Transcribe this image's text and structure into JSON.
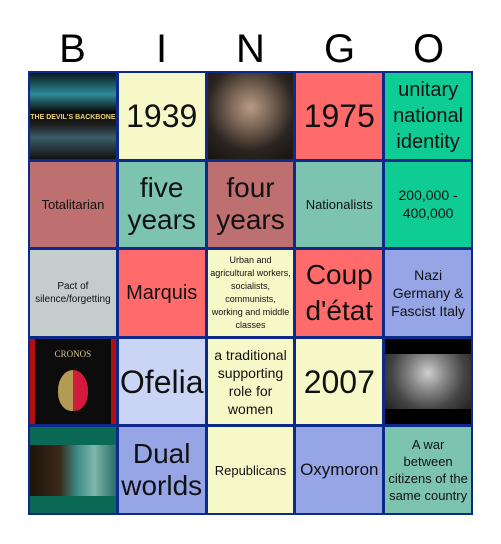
{
  "header": {
    "letters": [
      "B",
      "I",
      "N",
      "G",
      "O"
    ]
  },
  "colors": {
    "border": "#0d2a8a",
    "light_yellow": "#f7f8c8",
    "salmon": "#ff6b6b",
    "teal": "#0fcb94",
    "dusty_rose": "#be6f70",
    "seafoam": "#7dc4b0",
    "gray": "#c4cccc",
    "periwinkle": "#96a5e6",
    "lavender": "#cad5f5"
  },
  "cells": [
    {
      "type": "image",
      "image": "devils-backbone-poster",
      "caption": "THE DEVIL'S BACKBONE"
    },
    {
      "type": "text",
      "text": "1939"
    },
    {
      "type": "image",
      "image": "guillermo-del-toro-portrait"
    },
    {
      "type": "text",
      "text": "1975"
    },
    {
      "type": "text",
      "text": "unitary national identity"
    },
    {
      "type": "text",
      "text": "Totalitarian"
    },
    {
      "type": "text",
      "text": "five years"
    },
    {
      "type": "text",
      "text": "four years"
    },
    {
      "type": "text",
      "text": "Nationalists"
    },
    {
      "type": "text",
      "text": "200,000 - 400,000"
    },
    {
      "type": "text",
      "text": "Pact of silence/forgetting"
    },
    {
      "type": "text",
      "text": "Marquis"
    },
    {
      "type": "text",
      "text": "Urban and agricultural workers, socialists, communists, working and middle classes"
    },
    {
      "type": "text",
      "text": "Coup d'état"
    },
    {
      "type": "text",
      "text": "Nazi Germany & Fascist Italy"
    },
    {
      "type": "image",
      "image": "cronos-poster",
      "caption": "CRONOS"
    },
    {
      "type": "text",
      "text": "Ofelia"
    },
    {
      "type": "text",
      "text": "a traditional supporting role for women"
    },
    {
      "type": "text",
      "text": "2007"
    },
    {
      "type": "image",
      "image": "franco-portrait"
    },
    {
      "type": "image",
      "image": "shape-of-water-still"
    },
    {
      "type": "text",
      "text": "Dual worlds"
    },
    {
      "type": "text",
      "text": "Republicans"
    },
    {
      "type": "text",
      "text": "Oxymoron"
    },
    {
      "type": "text",
      "text": "A war between citizens of the same country"
    }
  ]
}
